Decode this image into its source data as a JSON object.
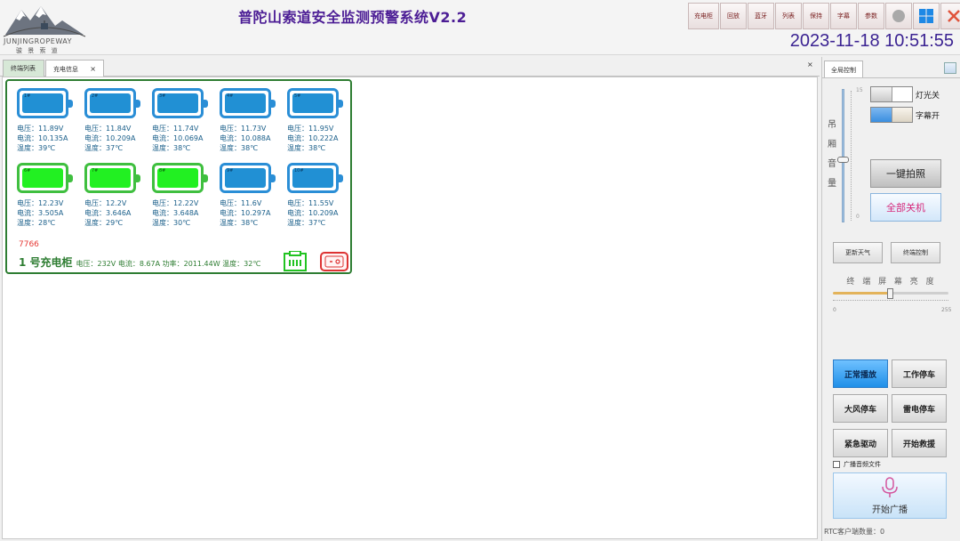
{
  "header": {
    "app_title": "普陀山索道安全监测预警系统V2.2",
    "logo_text": "JUNJINGROPEWAY",
    "logo_subtext": "骏 景 索 道",
    "datetime": "2023-11-18 10:51:55",
    "toolbar": [
      "充电柜",
      "回放",
      "蓝牙",
      "列表",
      "保持",
      "字幕",
      "参数"
    ],
    "window_icons": [
      "circle-icon",
      "windows-icon",
      "close-icon"
    ]
  },
  "tabs": [
    {
      "label": "终端列表",
      "active": false
    },
    {
      "label": "充电信息",
      "active": true,
      "close": "×"
    }
  ],
  "panel_close": "×",
  "cabinet": {
    "cells": [
      {
        "num": "1#",
        "voltage": "11.89V",
        "current": "10.135A",
        "temp": "39℃",
        "color": "blue"
      },
      {
        "num": "2#",
        "voltage": "11.84V",
        "current": "10.209A",
        "temp": "37℃",
        "color": "blue"
      },
      {
        "num": "3#",
        "voltage": "11.74V",
        "current": "10.069A",
        "temp": "38℃",
        "color": "blue"
      },
      {
        "num": "4#",
        "voltage": "11.73V",
        "current": "10.088A",
        "temp": "38℃",
        "color": "blue"
      },
      {
        "num": "5#",
        "voltage": "11.95V",
        "current": "10.222A",
        "temp": "38℃",
        "color": "blue"
      },
      {
        "num": "6#",
        "voltage": "12.23V",
        "current": "3.505A",
        "temp": "28℃",
        "color": "green"
      },
      {
        "num": "7#",
        "voltage": "12.2V",
        "current": "3.646A",
        "temp": "29℃",
        "color": "green"
      },
      {
        "num": "8#",
        "voltage": "12.22V",
        "current": "3.648A",
        "temp": "30℃",
        "color": "green"
      },
      {
        "num": "9#",
        "voltage": "11.6V",
        "current": "10.297A",
        "temp": "38℃",
        "color": "blue"
      },
      {
        "num": "10#",
        "voltage": "11.55V",
        "current": "10.209A",
        "temp": "37℃",
        "color": "blue"
      }
    ],
    "labels": {
      "voltage": "电压：",
      "current": "电流：",
      "temp": "温度："
    },
    "id_code": "7766",
    "name": "1 号充电柜",
    "summary": "电压：232V 电流：8.67A 功率：2011.44W 温度：32℃",
    "power_switch": "[-o]"
  },
  "right_panel": {
    "tab_label": "全局控制",
    "volume_label": [
      "吊",
      "厢",
      "音",
      "量"
    ],
    "volume_max": "15",
    "volume_min": "0",
    "volume_level": 0.5,
    "light_toggle": "灯光关",
    "subtitle_toggle": "字幕开",
    "snapshot_button": "一键拍照",
    "all_off_button": "全部关机",
    "update_weather_button": "更新天气",
    "terminal_control_button": "终端控制",
    "brightness_label": "终 端 屏 幕 亮 度",
    "brightness_min": "0",
    "brightness_max": "255",
    "modes": {
      "normal": "正常播放",
      "work_stop": "工作停车",
      "wind_stop": "大风停车",
      "thunder_stop": "雷电停车",
      "emergency": "紧急驱动",
      "rescue": "开始救援"
    },
    "broadcast_audio_file": "广播音频文件",
    "broadcast_button": "开始广播",
    "rtc_status": "RTC客户端数量：0"
  },
  "colors": {
    "title": "#4c1d95",
    "datetime": "#3b2392",
    "cabinet_border": "#2e7d32",
    "battery_blue": "#2190d4",
    "battery_green": "#22f022",
    "alert_red": "#e53935"
  }
}
